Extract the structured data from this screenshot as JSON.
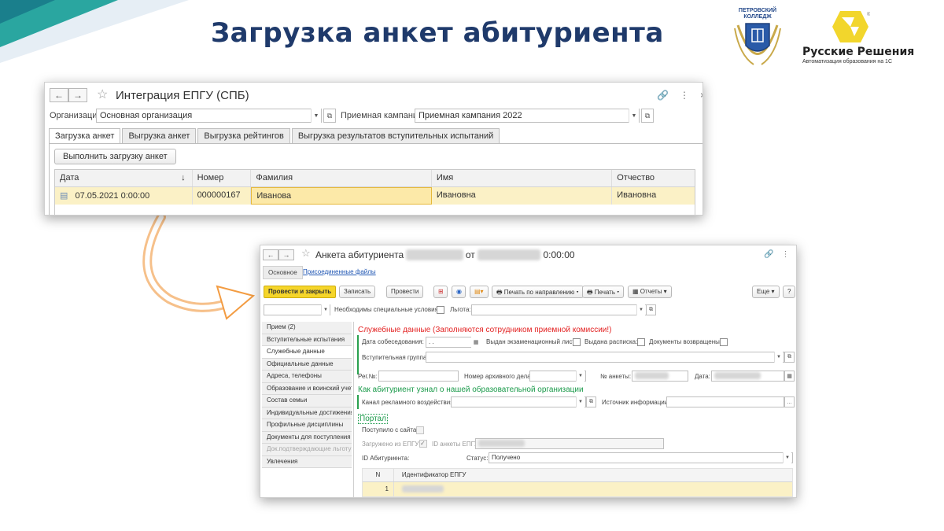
{
  "slide": {
    "title": "Загрузка анкет абитуриента",
    "logo1_text": "ПЕТРОВСКИЙ КОЛЛЕДЖ",
    "logo2_name": "Русские Решения",
    "logo2_sub": "Автоматизация образования на 1С",
    "colors": {
      "title": "#1f3a6b",
      "accent_teal": "#2aa6a0",
      "accent_yellow": "#f2d62c",
      "arrow_orange": "#f39c42"
    }
  },
  "win1": {
    "title": "Интеграция ЕПГУ (СПБ)",
    "org_label": "Организация:",
    "org_value": "Основная организация",
    "campaign_label": "Приемная кампания:",
    "campaign_value": "Приемная кампания 2022",
    "tabs": [
      "Загрузка анкет",
      "Выгрузка анкет",
      "Выгрузка рейтингов",
      "Выгрузка результатов вступительных испытаний"
    ],
    "run_button": "Выполнить загрузку анкет",
    "columns": [
      "Дата",
      "Номер",
      "Фамилия",
      "Имя",
      "Отчество"
    ],
    "sort_indicator": "↓",
    "row": {
      "date": "07.05.2021 0:00:00",
      "number": "000000167",
      "surname": "Иванова",
      "name": "Ивановна",
      "patronymic": "Ивановна"
    }
  },
  "win2": {
    "title_prefix": "Анкета абитуриента",
    "title_mid": "от",
    "title_time": "0:00:00",
    "tab_main": "Основное",
    "tab_files": "Присоединенные файлы",
    "toolbar": {
      "post_close": "Провести и закрыть",
      "save": "Записать",
      "post": "Провести",
      "print_direction": "Печать по направлению",
      "print": "Печать",
      "reports": "Отчеты",
      "more": "Еще",
      "help": "?"
    },
    "special_conditions": "Необходимы специальные условия:",
    "benefit": "Льгота:",
    "side_items": [
      "Прием (2)",
      "Вступительные испытания",
      "Служебные данные",
      "Официальные данные",
      "Адреса, телефоны",
      "Образование и воинский учет",
      "Состав семьи",
      "Индивидуальные достижения",
      "Профильные дисциплины",
      "Документы для поступления",
      "Док.подтверждающие льготу",
      "Увлечения"
    ],
    "service_header": "Служебные данные (Заполняются сотрудником приемной комиссии!)",
    "interview_date": "Дата собеседования:",
    "date_placeholder": ". .",
    "exam_sheet": "Выдан экзаменационный лист:",
    "receipt": "Выдана расписка:",
    "docs_returned": "Документы возвращены:",
    "entrance_group": "Вступительная группа:",
    "reg_no": "Рег.№:",
    "archive_no": "Номер архивного дела:",
    "form_no": "№ анкеты:",
    "date": "Дата:",
    "how_header": "Как абитуриент узнал о нашей образовательной организации",
    "ad_channel": "Канал рекламного воздействия:",
    "info_source": "Источник информации:",
    "portal_header": "Портал",
    "from_site": "Поступило с сайта:",
    "loaded_epgu": "Загружено из ЕПГУ:",
    "epgu_form_id": "ID анкеты ЕПГУ:",
    "applicant_id": "ID Абитуриента:",
    "status_label": "Статус:",
    "status_value": "Получено",
    "table_cols": [
      "N",
      "Идентификатор ЕПГУ"
    ],
    "table_row_n": "1",
    "ellipsis": "..."
  }
}
